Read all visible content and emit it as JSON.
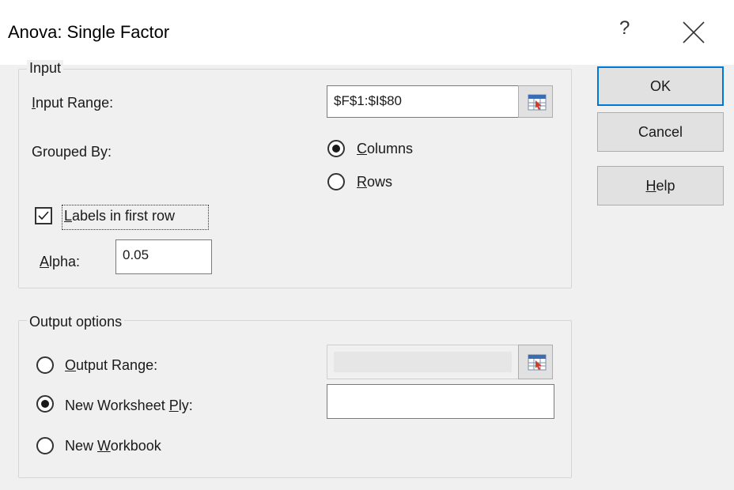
{
  "window": {
    "title": "Anova: Single Factor",
    "help_glyph": "?"
  },
  "input_group": {
    "legend": "Input",
    "input_range_label": {
      "mnemonic": "I",
      "rest": "nput Range:"
    },
    "input_range_value": "$F$1:$I$80",
    "grouped_by_label": "Grouped By:",
    "columns_option": {
      "mnemonic": "C",
      "rest": "olumns",
      "checked": true
    },
    "rows_option": {
      "mnemonic": "R",
      "rest": "ows",
      "checked": false
    },
    "labels_first_row": {
      "mnemonic": "L",
      "rest": "abels in first row",
      "checked": true
    },
    "alpha_label": {
      "mnemonic": "A",
      "rest": "lpha:"
    },
    "alpha_value": "0.05"
  },
  "output_group": {
    "legend": "Output options",
    "output_range": {
      "mnemonic": "O",
      "rest": "utput Range:",
      "checked": false,
      "value": ""
    },
    "new_worksheet_ply": {
      "before": "New Worksheet ",
      "mnemonic": "P",
      "rest": "ly:",
      "checked": true,
      "value": ""
    },
    "new_workbook": {
      "before": "New ",
      "mnemonic": "W",
      "rest": "orkbook",
      "checked": false
    }
  },
  "buttons": {
    "ok": "OK",
    "cancel": "Cancel",
    "help": {
      "mnemonic": "H",
      "rest": "elp"
    }
  },
  "colors": {
    "dialog_bg": "#f0f0f0",
    "default_button_border": "#0078d7"
  },
  "icons": {
    "close": "close-x-icon",
    "range_selector": "collapse-dialog-icon"
  }
}
